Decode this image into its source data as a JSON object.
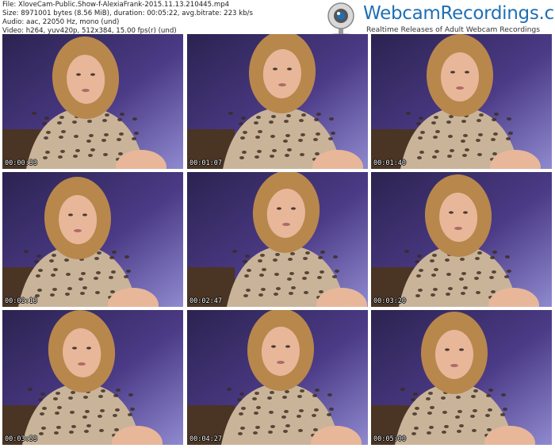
{
  "file_info": {
    "file": "File: XloveCam-Public.Show-f-AlexiaFrank-2015.11.13.210445.mp4",
    "size": "Size: 8971001 bytes (8.56 MiB), duration: 00:05:22, avg.bitrate: 223 kb/s",
    "audio": "Audio: aac, 22050 Hz, mono (und)",
    "video": "Video: h264, yuv420p, 512x384, 15.00 fps(r) (und)"
  },
  "logo": {
    "title": "WebcamRecordings.com",
    "subtitle": "Realtime Releases of Adult Webcam Recordings",
    "icon": "webcam-icon"
  },
  "thumbnails": [
    {
      "timestamp": "00:00:33"
    },
    {
      "timestamp": "00:01:07"
    },
    {
      "timestamp": "00:01:40"
    },
    {
      "timestamp": "00:02:13"
    },
    {
      "timestamp": "00:02:47"
    },
    {
      "timestamp": "00:03:20"
    },
    {
      "timestamp": "00:03:53"
    },
    {
      "timestamp": "00:04:27"
    },
    {
      "timestamp": "00:05:00"
    }
  ],
  "colors": {
    "logo_blue": "#1f6fb4",
    "background_purple": "#4b3a86",
    "hair": "#b8874c",
    "skin": "#e8b79a",
    "leopard": "#c9b49a"
  }
}
